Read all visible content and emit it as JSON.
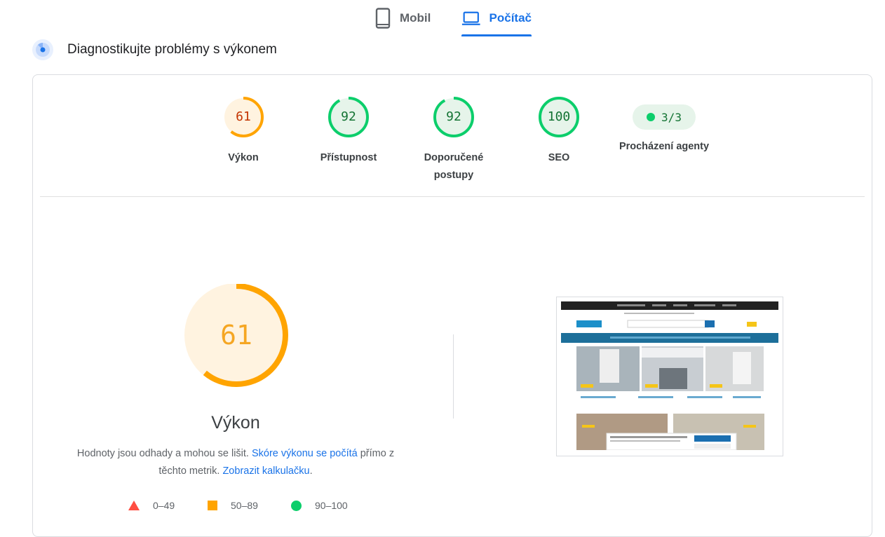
{
  "tabs": {
    "mobile": "Mobil",
    "desktop": "Počítač"
  },
  "diagnostics": {
    "title": "Diagnostikujte problémy s výkonem"
  },
  "categories": [
    {
      "score": "61",
      "label": "Výkon",
      "color": "#fa3",
      "fill": 0.61
    },
    {
      "score": "92",
      "label": "Přístupnost",
      "color": "#0cce6b",
      "fill": 0.92
    },
    {
      "score": "92",
      "label": "Doporučené postupy",
      "color": "#0cce6b",
      "fill": 0.92
    },
    {
      "score": "100",
      "label": "SEO",
      "color": "#0cce6b",
      "fill": 1.0
    }
  ],
  "agents": {
    "value": "3/3",
    "label": "Procházení agenty"
  },
  "performance": {
    "score": "61",
    "fill": 0.61,
    "title": "Výkon",
    "desc_part1": "Hodnoty jsou odhady a mohou se lišit. ",
    "desc_link1": "Skóre výkonu se počítá",
    "desc_part2": " přímo z těchto metrik. ",
    "desc_link2": "Zobrazit kalkulačku",
    "desc_part3": "."
  },
  "legend": {
    "fail": "0–49",
    "average": "50–89",
    "pass": "90–100"
  },
  "colors": {
    "accent": "#1a73e8",
    "fail": "#ff4e42",
    "average": "#ffa400",
    "pass": "#0cce6b"
  }
}
